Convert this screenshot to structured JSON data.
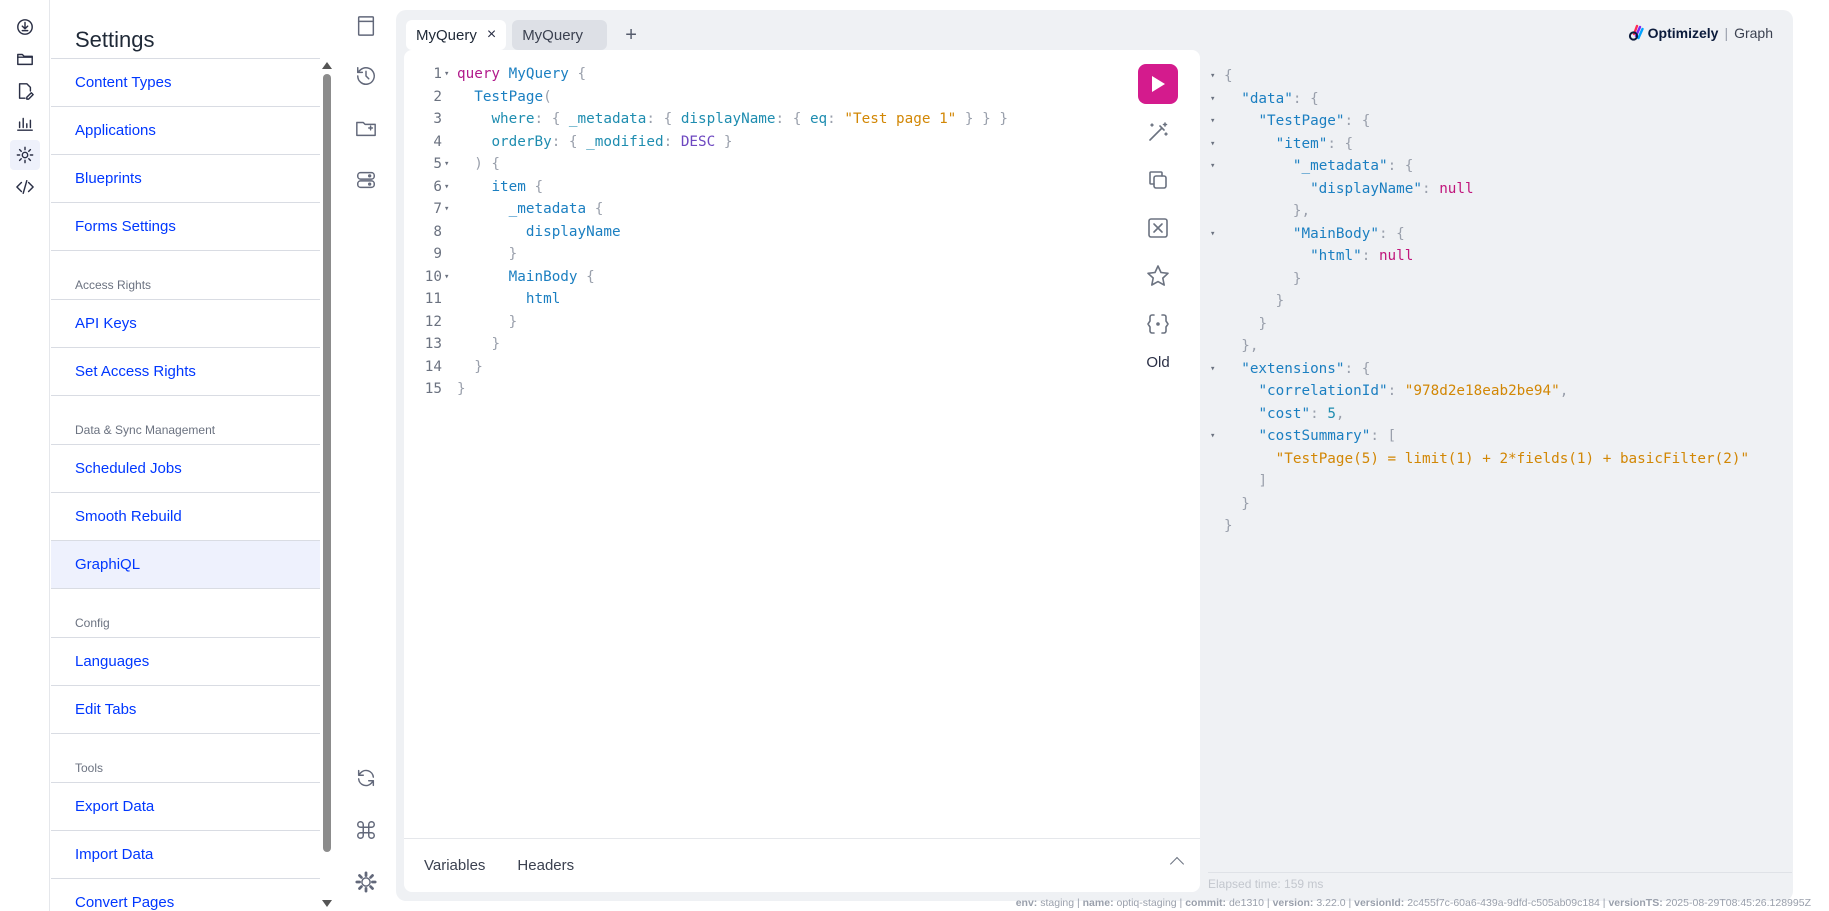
{
  "settings": {
    "title": "Settings",
    "groups": [
      {
        "section": "",
        "items": [
          "Content Types",
          "Applications",
          "Blueprints",
          "Forms Settings"
        ]
      },
      {
        "section": "Access Rights",
        "items": [
          "API Keys",
          "Set Access Rights"
        ]
      },
      {
        "section": "Data & Sync Management",
        "items": [
          "Scheduled Jobs",
          "Smooth Rebuild",
          "GraphiQL"
        ]
      },
      {
        "section": "Config",
        "items": [
          "Languages",
          "Edit Tabs"
        ]
      },
      {
        "section": "Tools",
        "items": [
          "Export Data",
          "Import Data",
          "Convert Pages"
        ]
      }
    ],
    "active_item": "GraphiQL"
  },
  "tabs": {
    "active_label": "MyQuery",
    "inactive_label": "MyQuery",
    "close_symbol": "×",
    "add_symbol": "+"
  },
  "brand": {
    "name": "Optimizely",
    "separator": "|",
    "product": "Graph"
  },
  "editor": {
    "old_label": "Old",
    "bottom_tabs": [
      "Variables",
      "Headers"
    ]
  },
  "query_lines": [
    "1",
    "2",
    "3",
    "4",
    "5",
    "6",
    "7",
    "8",
    "9",
    "10",
    "11",
    "12",
    "13",
    "14",
    "15"
  ],
  "query": {
    "keyword_query": "query",
    "operation_name": "MyQuery",
    "type_name": "TestPage",
    "arg_where": "where",
    "arg_metadata": "_metadata",
    "arg_displayName": "displayName",
    "arg_eq": "eq",
    "filter_value": "\"Test page 1\"",
    "arg_orderBy": "orderBy",
    "arg_modified": "_modified",
    "enum_desc": "DESC",
    "field_item": "item",
    "field_metadata": "_metadata",
    "field_displayName": "displayName",
    "field_mainbody": "MainBody",
    "field_html": "html"
  },
  "result": {
    "key_data": "\"data\"",
    "key_testpage": "\"TestPage\"",
    "key_item": "\"item\"",
    "key_metadata": "\"_metadata\"",
    "key_displayName": "\"displayName\"",
    "key_mainbody": "\"MainBody\"",
    "key_html": "\"html\"",
    "null_value": "null",
    "key_extensions": "\"extensions\"",
    "key_correlationId": "\"correlationId\"",
    "correlationId_value": "\"978d2e18eab2be94\"",
    "key_cost": "\"cost\"",
    "cost_value": "5",
    "key_costSummary": "\"costSummary\"",
    "costSummary_value": "\"TestPage(5) = limit(1) + 2*fields(1) + basicFilter(2)\"",
    "elapsed": "Elapsed time: 159 ms"
  },
  "footer": {
    "env_label": "env:",
    "env_value": "staging",
    "name_label": "name:",
    "name_value": "optiq-staging",
    "commit_label": "commit:",
    "commit_value": "de1310",
    "version_label": "version:",
    "version_value": "3.22.0",
    "versionId_label": "versionId:",
    "versionId_value": "2c455f7c-60a6-439a-9dfd-c505ab09c184",
    "versionTS_label": "versionTS:",
    "versionTS_value": "2025-08-29T08:45:26.128995Z"
  },
  "colors": {
    "accent": "#0037ff",
    "run_button": "#d41b8d",
    "keyword": "#b11a8b",
    "string": "#d28705",
    "field": "#1b7fc1"
  }
}
